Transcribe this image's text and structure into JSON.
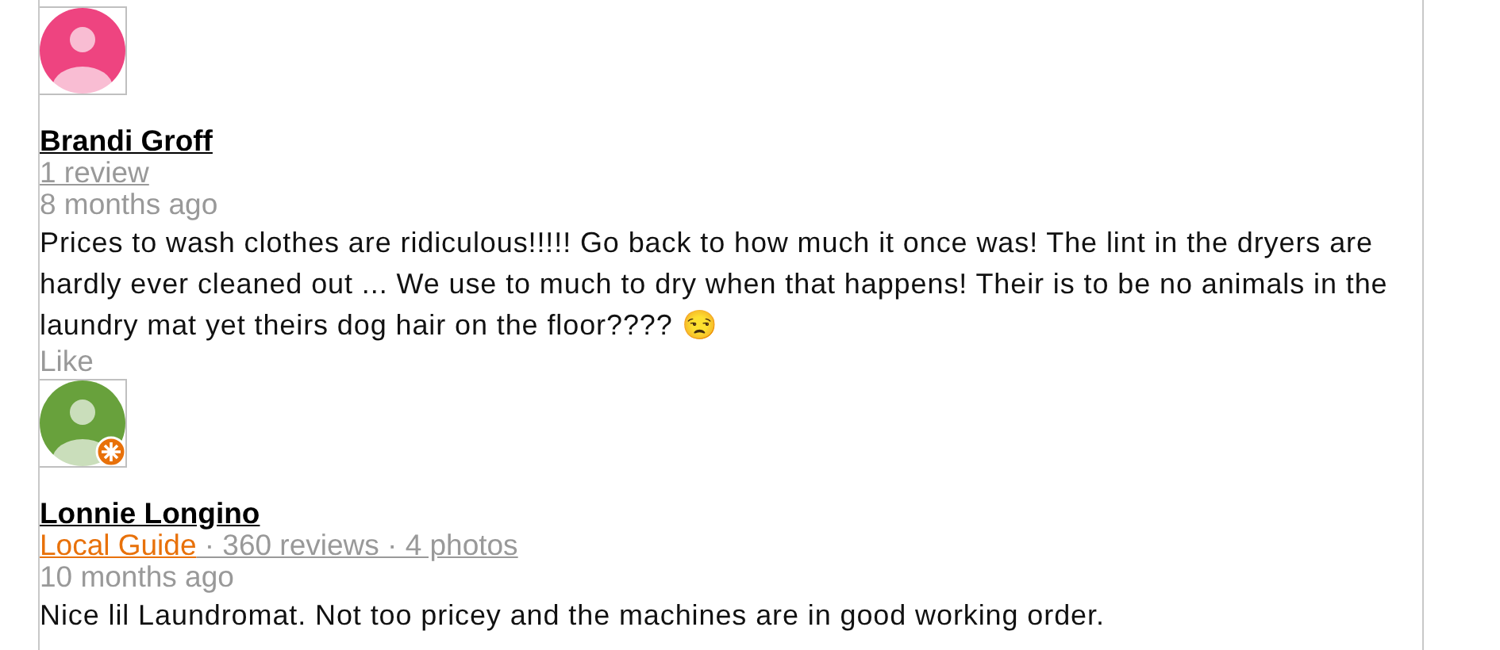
{
  "reviews": [
    {
      "name": "Brandi Groff",
      "color": "#ee4480",
      "stats": "1 review",
      "time": "8 months ago",
      "text": "Prices to wash clothes are ridiculous!!!!! Go back to how much it once was! The lint in the dryers are hardly ever cleaned out ... We use to much to dry when that happens! Their is to be no animals in the laundry mat yet theirs dog hair on the floor???? 😒",
      "like": "Like"
    },
    {
      "name": "Lonnie Longino",
      "color": "#68a13c",
      "local_guide": "Local Guide",
      "stats": " · 360 reviews · 4 photos",
      "time": "10 months ago",
      "text": "Nice lil Laundromat. Not too pricey and the machines are in good working order."
    }
  ]
}
